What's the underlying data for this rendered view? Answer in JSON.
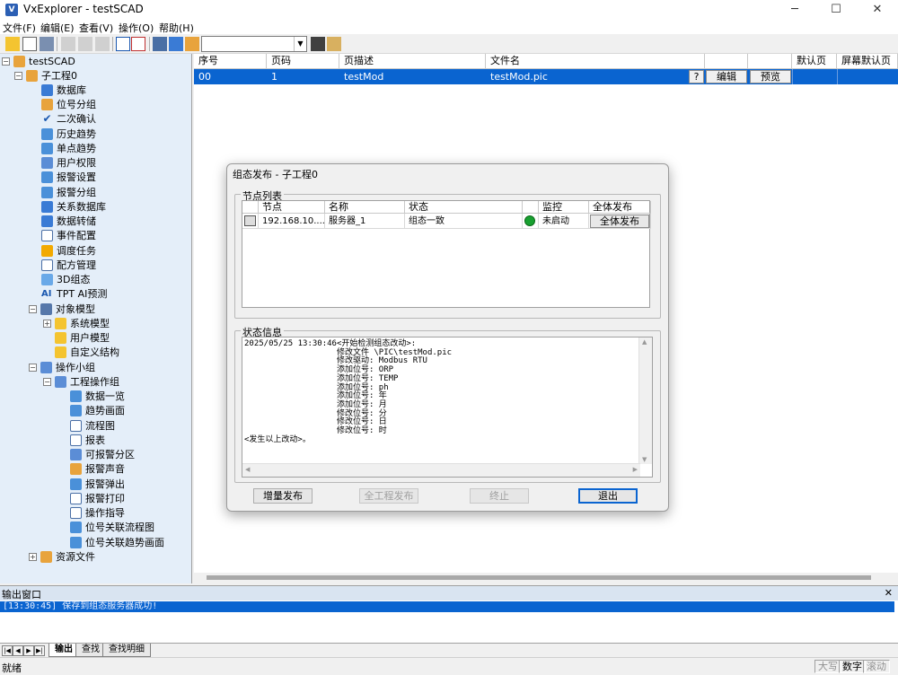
{
  "window": {
    "title": "VxExplorer - testSCAD",
    "minimize_glyph": "─",
    "maximize_glyph": "☐",
    "close_glyph": "✕"
  },
  "menu": [
    "文件(F)",
    "编辑(E)",
    "查看(V)",
    "操作(O)",
    "帮助(H)"
  ],
  "toolbar": {
    "combo_value": "",
    "combo_arrow": "▼"
  },
  "tree": {
    "root": "testSCAD",
    "project": "子工程0",
    "items": [
      "数据库",
      "位号分组",
      "二次确认",
      "历史趋势",
      "单点趋势",
      "用户权限",
      "报警设置",
      "报警分组",
      "关系数据库",
      "数据转储",
      "事件配置",
      "调度任务",
      "配方管理",
      "3D组态",
      "TPT AI预测"
    ],
    "object_model": "对象模型",
    "object_model_children": [
      "系统模型",
      "用户模型",
      "自定义结构"
    ],
    "op_group": "操作小组",
    "op_subgroup": "工程操作组",
    "op_children": [
      "数据一览",
      "趋势画面",
      "流程图",
      "报表",
      "可报警分区",
      "报警声音",
      "报警弹出",
      "报警打印",
      "操作指导",
      "位号关联流程图",
      "位号关联趋势画面"
    ],
    "resources": "资源文件",
    "ai_glyph": "AI",
    "check_glyph": "✔",
    "plus": "+",
    "minus": "−"
  },
  "grid": {
    "headers": [
      "序号",
      "页码",
      "页描述",
      "文件名",
      "",
      "",
      "默认页",
      "屏幕默认页"
    ],
    "row": {
      "index": "00",
      "page": "1",
      "desc": "testMod",
      "file": "testMod.pic",
      "help_btn": "?",
      "edit_btn": "编辑",
      "preview_btn": "预览"
    }
  },
  "output": {
    "title": "输出窗口",
    "close_glyph": "✕",
    "line": "[13:30:45] 保存到组态服务器成功!",
    "tabs": [
      "输出",
      "查找",
      "查找明细"
    ],
    "nav": [
      "|◀",
      "◀",
      "▶",
      "▶|"
    ]
  },
  "statusbar": {
    "text": "就绪",
    "indicators": [
      "大写",
      "数字",
      "滚动"
    ]
  },
  "dialog": {
    "title": "组态发布 - 子工程0",
    "node_group_label": "节点列表",
    "node_headers": [
      "节点",
      "名称",
      "状态",
      "监控",
      "全体发布"
    ],
    "node_row": {
      "node": "192.168.10....",
      "name": "服务器_1",
      "status": "组态一致",
      "monitor": "未启动",
      "publish_btn": "全体发布"
    },
    "status_group_label": "状态信息",
    "status_lines": [
      "2025/05/25 13:30:46<开始检测组态改动>:",
      "                   修改文件 \\PIC\\testMod.pic",
      "                   修改驱动: Modbus RTU",
      "                   添加位号: ORP",
      "                   添加位号: TEMP",
      "                   添加位号: ph",
      "                   添加位号: 年",
      "                   添加位号: 月",
      "                   修改位号: 分",
      "                   修改位号: 日",
      "                   修改位号: 时",
      "<发生以上改动>。"
    ],
    "buttons": {
      "incremental": "增量发布",
      "full_project": "全工程发布",
      "stop": "终止",
      "exit": "退出"
    },
    "scroll_up": "▲",
    "scroll_down": "▼",
    "scroll_left": "◀",
    "scroll_right": "▶"
  }
}
